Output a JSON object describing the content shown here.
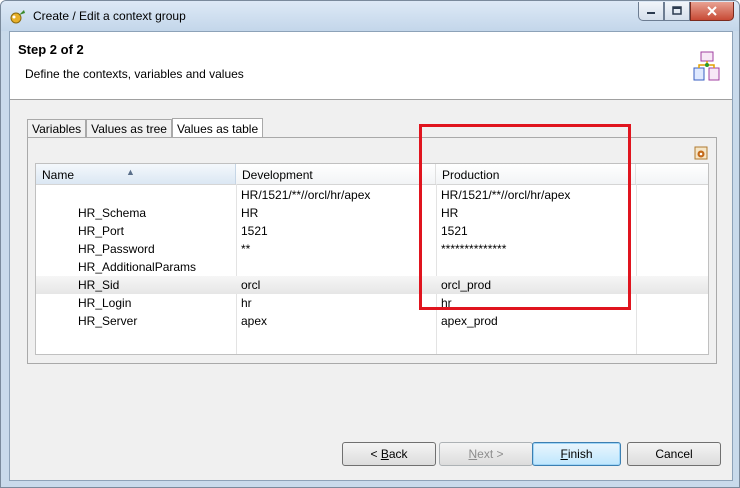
{
  "window": {
    "title": "Create / Edit a context group"
  },
  "header": {
    "step": "Step 2 of 2",
    "description": "Define the contexts, variables and values"
  },
  "tabs": [
    {
      "label": "Variables"
    },
    {
      "label": "Values as tree"
    },
    {
      "label": "Values as table"
    }
  ],
  "table": {
    "columns": {
      "name": "Name",
      "development": "Development",
      "production": "Production"
    },
    "rows": [
      {
        "name": "",
        "development": "HR/1521/**//orcl/hr/apex",
        "production": "HR/1521/**//orcl/hr/apex"
      },
      {
        "name": "HR_Schema",
        "development": "HR",
        "production": "HR"
      },
      {
        "name": "HR_Port",
        "development": "1521",
        "production": "1521"
      },
      {
        "name": "HR_Password",
        "development": "**",
        "production": "**************"
      },
      {
        "name": "HR_AdditionalParams",
        "development": "",
        "production": ""
      },
      {
        "name": "HR_Sid",
        "development": "orcl",
        "production": "orcl_prod"
      },
      {
        "name": "HR_Login",
        "development": "hr",
        "production": "hr"
      },
      {
        "name": "HR_Server",
        "development": "apex",
        "production": "apex_prod"
      }
    ]
  },
  "buttons": {
    "back": {
      "mnemonic": "B",
      "rest": "ack",
      "prefix": "< "
    },
    "next": {
      "mnemonic": "N",
      "rest": "ext >"
    },
    "finish": {
      "mnemonic": "F",
      "rest": "inish"
    },
    "cancel": {
      "label": "Cancel"
    }
  },
  "colors": {
    "highlight_box": "#e0141e",
    "titlebar": "#c9daeb"
  }
}
